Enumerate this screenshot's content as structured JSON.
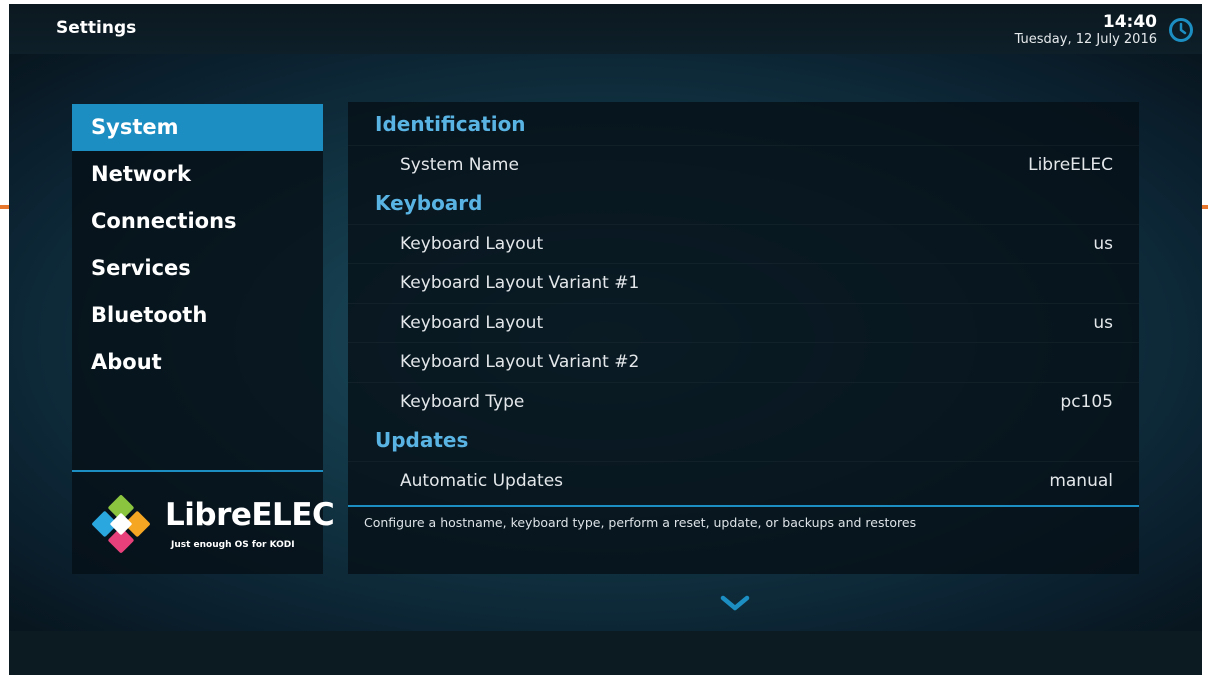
{
  "header": {
    "title": "Settings",
    "time": "14:40",
    "date": "Tuesday, 12 July 2016",
    "clock_icon": "clock-icon"
  },
  "sidebar": {
    "items": [
      {
        "label": "System",
        "active": true
      },
      {
        "label": "Network",
        "active": false
      },
      {
        "label": "Connections",
        "active": false
      },
      {
        "label": "Services",
        "active": false
      },
      {
        "label": "Bluetooth",
        "active": false
      },
      {
        "label": "About",
        "active": false
      }
    ],
    "logo": {
      "name": "LibreELEC",
      "tagline": "Just enough OS for KODI",
      "icon": "libreelec-logo-icon"
    }
  },
  "settings": {
    "sections": [
      {
        "title": "Identification",
        "rows": [
          {
            "label": "System Name",
            "value": "LibreELEC"
          }
        ]
      },
      {
        "title": "Keyboard",
        "rows": [
          {
            "label": "Keyboard Layout",
            "value": "us"
          },
          {
            "label": "Keyboard Layout Variant #1",
            "value": ""
          },
          {
            "label": "Keyboard Layout",
            "value": "us"
          },
          {
            "label": "Keyboard Layout Variant #2",
            "value": ""
          },
          {
            "label": "Keyboard Type",
            "value": "pc105"
          }
        ]
      },
      {
        "title": "Updates",
        "rows": [
          {
            "label": "Automatic Updates",
            "value": "manual"
          }
        ]
      }
    ],
    "description": "Configure a hostname, keyboard type, perform a reset, update, or backups and restores"
  },
  "scroll_icon": "chevron-down-icon",
  "colors": {
    "accent": "#1c8ec2",
    "section_header": "#59b3e3",
    "text": "#e3e7ea"
  }
}
